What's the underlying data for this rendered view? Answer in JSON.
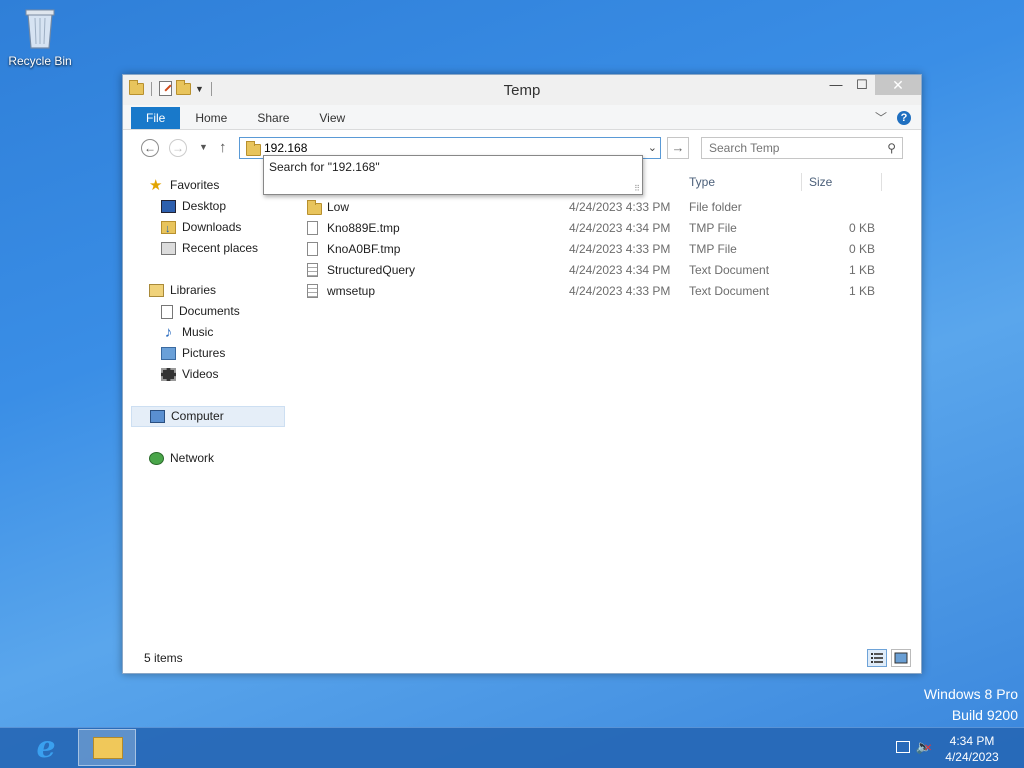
{
  "desktop": {
    "recycle_bin_label": "Recycle Bin",
    "watermark_line1": "Windows 8 Pro",
    "watermark_line2": "Build 9200"
  },
  "window": {
    "title": "Temp",
    "controls": {
      "minimize": "—",
      "maximize": "☐",
      "close": "✕"
    }
  },
  "ribbon": {
    "tabs": [
      "File",
      "Home",
      "Share",
      "View"
    ]
  },
  "navbar": {
    "address_value": "192.168",
    "search_placeholder": "Search Temp"
  },
  "suggestion": {
    "text": "Search for \"192.168\""
  },
  "nav_pane": {
    "favorites": {
      "label": "Favorites",
      "items": [
        "Desktop",
        "Downloads",
        "Recent places"
      ]
    },
    "libraries": {
      "label": "Libraries",
      "items": [
        "Documents",
        "Music",
        "Pictures",
        "Videos"
      ]
    },
    "computer": "Computer",
    "network": "Network"
  },
  "columns": {
    "type": "Type",
    "size": "Size"
  },
  "files": [
    {
      "name": "Low",
      "date": "4/24/2023 4:33 PM",
      "type": "File folder",
      "size": "",
      "icon": "folder-icon"
    },
    {
      "name": "Kno889E.tmp",
      "date": "4/24/2023 4:34 PM",
      "type": "TMP File",
      "size": "0 KB",
      "icon": "file-icon"
    },
    {
      "name": "KnoA0BF.tmp",
      "date": "4/24/2023 4:33 PM",
      "type": "TMP File",
      "size": "0 KB",
      "icon": "file-icon"
    },
    {
      "name": "StructuredQuery",
      "date": "4/24/2023 4:34 PM",
      "type": "Text Document",
      "size": "1 KB",
      "icon": "text-file-icon"
    },
    {
      "name": "wmsetup",
      "date": "4/24/2023 4:33 PM",
      "type": "Text Document",
      "size": "1 KB",
      "icon": "text-file-icon"
    }
  ],
  "status": {
    "item_count": "5 items"
  },
  "taskbar": {
    "time": "4:34 PM",
    "date": "4/24/2023"
  },
  "colors": {
    "desktop_bg": "#3a8ee6",
    "file_tab": "#1979ca",
    "taskbar": "#2667b5"
  }
}
